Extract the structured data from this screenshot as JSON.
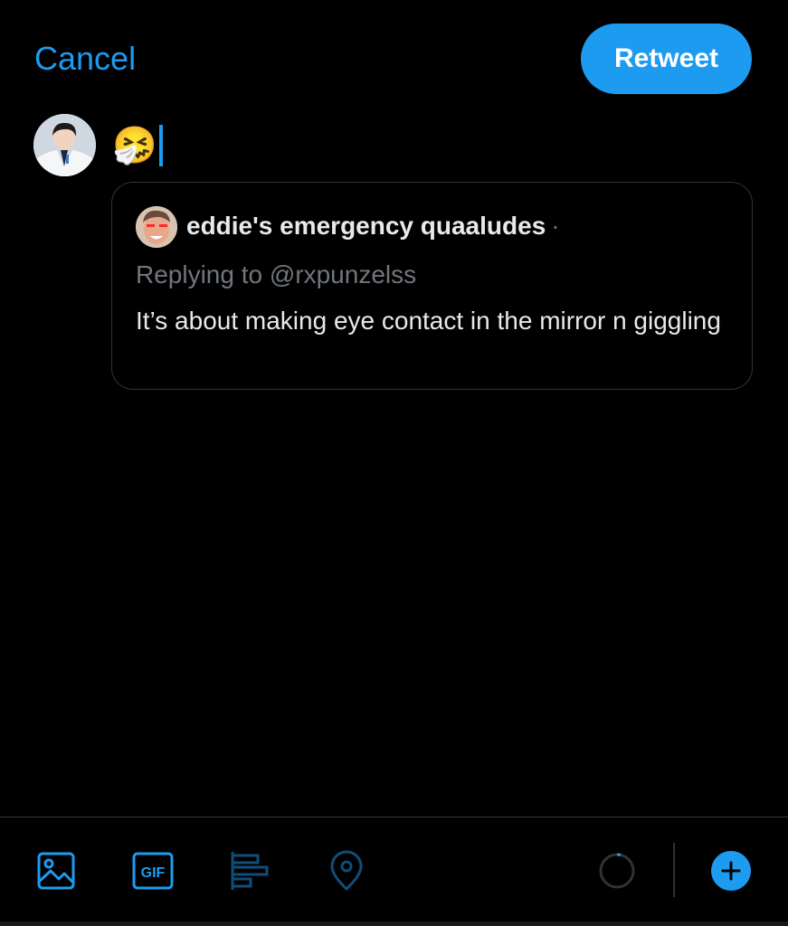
{
  "header": {
    "cancel_label": "Cancel",
    "retweet_label": "Retweet"
  },
  "composer": {
    "text": "🤧"
  },
  "quote": {
    "author_name": "eddie's emergency quaaludes",
    "separator": "·",
    "replying_to": "Replying to @rxpunzelss",
    "body": "It’s about making eye contact in the mirror n giggling"
  },
  "toolbar": {
    "gif_label": "GIF",
    "icons": [
      "image-icon",
      "gif-icon",
      "poll-icon",
      "location-icon",
      "character-count-ring",
      "add-tweet-icon"
    ]
  },
  "colors": {
    "accent": "#1d9bf0",
    "background": "#000000",
    "border": "#2f3336",
    "secondary_text": "#71767b",
    "primary_text": "#e7e9ea"
  }
}
